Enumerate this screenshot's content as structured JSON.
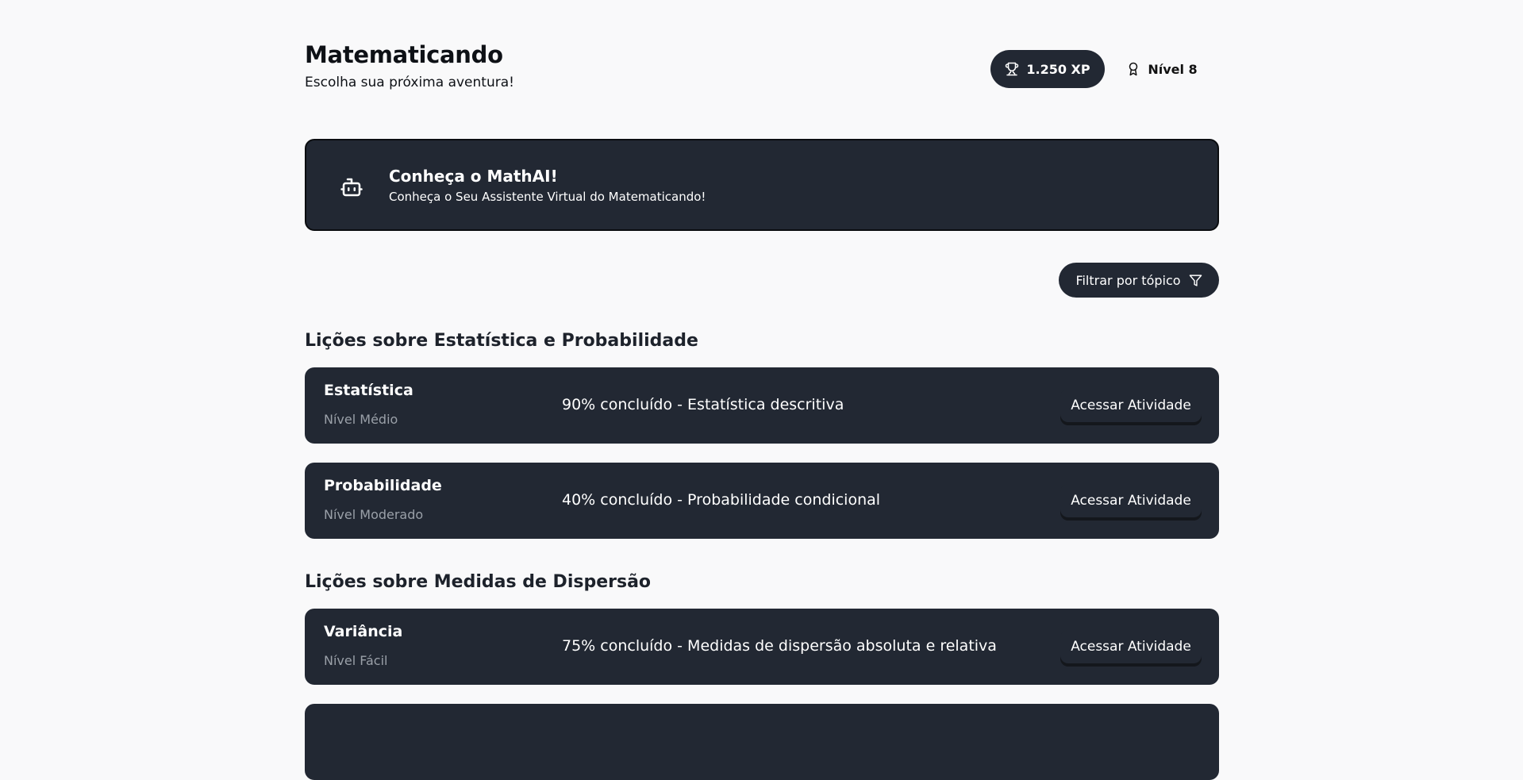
{
  "header": {
    "title": "Matematicando",
    "subtitle": "Escolha sua próxima aventura!",
    "xp_label": "1.250 XP",
    "level_label": "Nível 8"
  },
  "banner": {
    "title": "Conheça o MathAI!",
    "description": "Conheça o Seu Assistente Virtual do Matematicando!"
  },
  "filter": {
    "label": "Filtrar por tópico"
  },
  "sections": [
    {
      "title": "Lições sobre Estatística e Probabilidade",
      "lessons": [
        {
          "name": "Estatística",
          "level": "Nível Médio",
          "progress": "90% concluído - Estatística descritiva",
          "button": "Acessar Atividade"
        },
        {
          "name": "Probabilidade",
          "level": "Nível Moderado",
          "progress": "40% concluído - Probabilidade condicional",
          "button": "Acessar Atividade"
        }
      ]
    },
    {
      "title": "Lições sobre Medidas de Dispersão",
      "lessons": [
        {
          "name": "Variância",
          "level": "Nível Fácil",
          "progress": "75% concluído - Medidas de dispersão absoluta e relativa",
          "button": "Acessar Atividade"
        }
      ]
    }
  ],
  "icons": {
    "xp": "trophy-icon",
    "level": "award-icon",
    "banner": "bot-icon",
    "filter": "filter-icon"
  }
}
